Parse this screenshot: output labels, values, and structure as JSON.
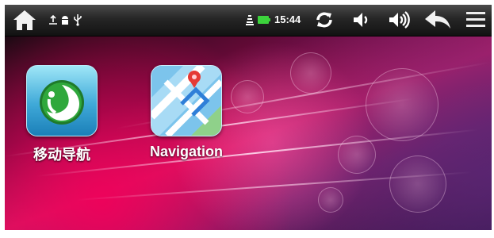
{
  "status_bar": {
    "time": "15:44",
    "icons": [
      "home-icon",
      "usb-connection-icon",
      "android-debug-icon",
      "usb-icon",
      "wifi-signal-icon",
      "battery-icon",
      "sync-icon",
      "volume-down-icon",
      "volume-up-icon",
      "back-icon",
      "menu-icon"
    ],
    "accent_color": "#3cd33c"
  },
  "desktop": {
    "apps": [
      {
        "label": "移动导航",
        "icon": "mobile-navigation-app-icon"
      },
      {
        "label": "Navigation",
        "icon": "navigation-map-icon"
      }
    ]
  }
}
